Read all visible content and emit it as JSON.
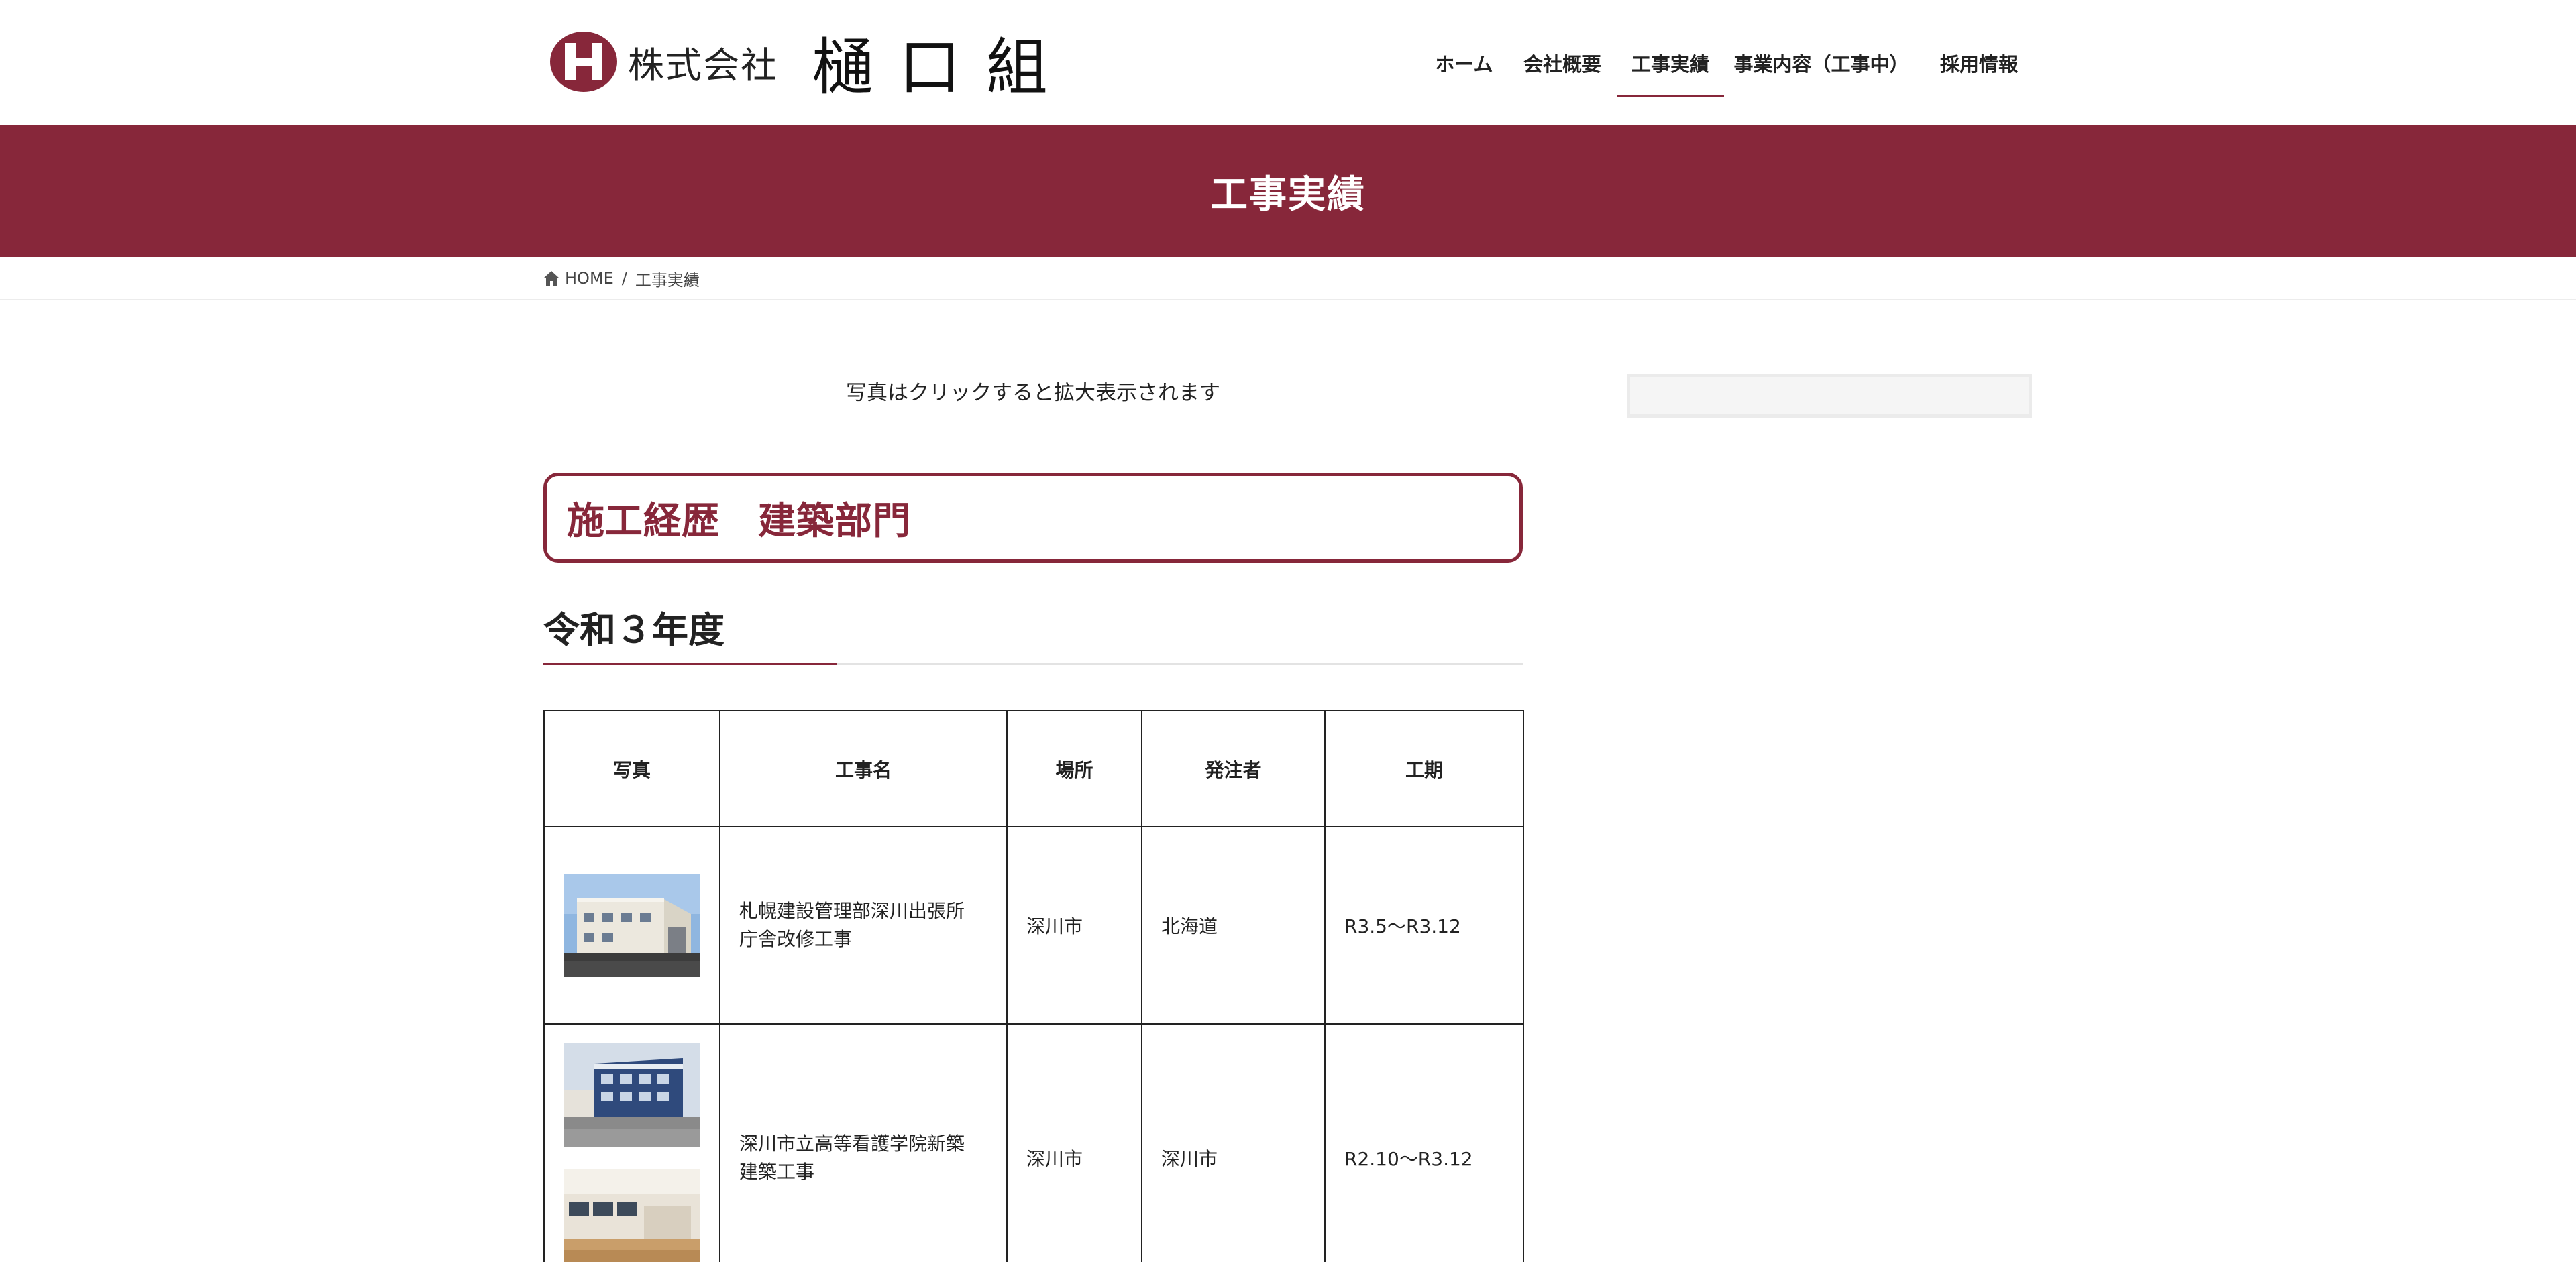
{
  "header": {
    "logo_company_type": "株式会社",
    "logo_company_name": "樋口組",
    "nav": [
      {
        "label": "ホーム",
        "active": false
      },
      {
        "label": "会社概要",
        "active": false
      },
      {
        "label": "工事実績",
        "active": true
      },
      {
        "label": "事業内容（工事中）",
        "active": false
      },
      {
        "label": "採用情報",
        "active": false
      }
    ]
  },
  "banner": {
    "title": "工事実績"
  },
  "breadcrumb": {
    "home": "HOME",
    "separator": "/",
    "current": "工事実績"
  },
  "main": {
    "notice": "写真はクリックすると拡大表示されます",
    "section_title": "施工経歴　建築部門",
    "year_heading": "令和３年度",
    "table": {
      "headers": [
        "写真",
        "工事名",
        "場所",
        "発注者",
        "工期"
      ],
      "rows": [
        {
          "name_line1": "札幌建設管理部深川出張所",
          "name_line2": "庁舎改修工事",
          "location": "深川市",
          "client": "北海道",
          "period": "R3.5〜R3.12"
        },
        {
          "name_line1": "深川市立高等看護学院新築",
          "name_line2": "建築工事",
          "location": "深川市",
          "client": "深川市",
          "period": "R2.10〜R3.12"
        }
      ]
    }
  },
  "colors": {
    "accent": "#87273a"
  },
  "icons": {
    "home": "home-icon",
    "logo": "logo-h-mark"
  }
}
